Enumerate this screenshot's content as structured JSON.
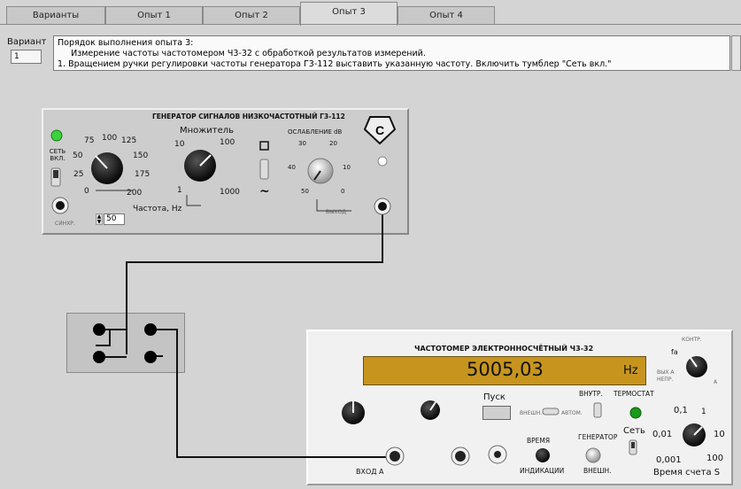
{
  "tabs": [
    "Варианты",
    "Опыт 1",
    "Опыт 2",
    "Опыт 3",
    "Опыт 4"
  ],
  "active_tab": "Опыт 3",
  "variant": {
    "label": "Вариант",
    "value": "1"
  },
  "instructions": {
    "line1": "Порядок выполнения опыта 3:",
    "line2": "     Измерение частоты частотомером Ч3-32 с обработкой результатов измерений.",
    "line3": "1. Вращением ручки регулировки частоты генератора Г3-112 выставить указанную частоту. Включить тумблер \"Сеть вкл.\""
  },
  "generator": {
    "title": "ГЕНЕРАТОР СИГНАЛОВ НИЗКОЧАСТОТНЫЙ  Г3-112",
    "power_label": "СЕТЬ ВКЛ.",
    "freq_ticks": [
      "75",
      "100",
      "125",
      "50",
      "150",
      "25",
      "175",
      "0",
      "200"
    ],
    "freq_label": "Частота, Hz",
    "freq_value": "50",
    "mult_label": "Множитель",
    "mult_ticks": [
      "10",
      "100",
      "1",
      "1000"
    ],
    "atten_label": "ОСЛАБЛЕНИЕ   dB",
    "atten_ticks": [
      "30",
      "20",
      "40",
      "10",
      "50",
      "0"
    ],
    "out_label": "ВЫХОД",
    "sync_label": "СИНХР.",
    "wave_sine": "~",
    "power_led_color": "#3cd23c"
  },
  "meter": {
    "title": "ЧАСТОТОМЕР ЭЛЕКТРОННОСЧЁТНЫЙ Ч3-32",
    "display_value": "5005,03",
    "display_unit": "Hz",
    "display_color": "#c7951e",
    "start_label": "Пуск",
    "ext_label": "ВНЕШН.",
    "auto_label": "АВТОМ.",
    "internal_label": "ВНУТР.",
    "thermostat_label": "ТЕРМОСТАТ",
    "generator_label": "ГЕНЕРАТОР",
    "network_label": "Сеть",
    "time_ind_top": "ВРЕМЯ",
    "time_ind_bottom": "ИНДИКАЦИИ",
    "ext2_label": "ВНЕШН.",
    "input_a": "ВХОД А",
    "count_label": "Время счета S",
    "count_ticks": [
      "0,1",
      "1",
      "0,01",
      "10",
      "0,001",
      "100"
    ],
    "mode_ticks": [
      "КОНТР.",
      "fa",
      "ВЫХ А",
      "НЕПР.",
      "A"
    ],
    "led_color": "#1a9a1a"
  },
  "wire_color": "#111111"
}
